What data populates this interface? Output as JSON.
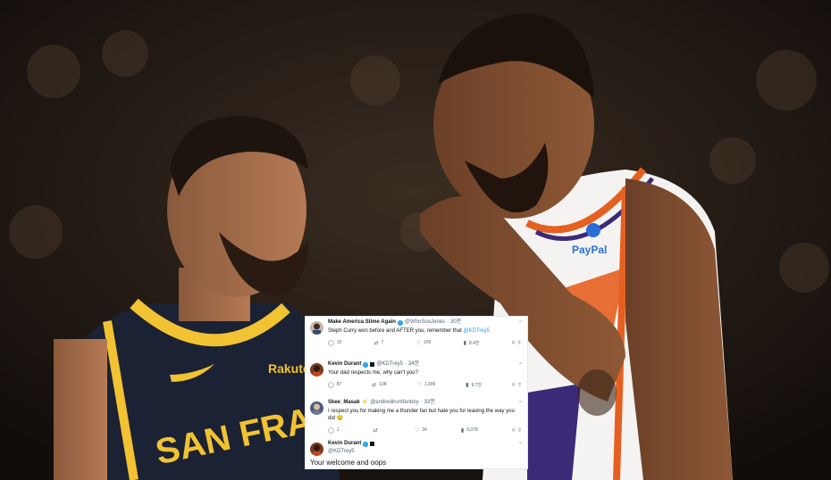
{
  "tweets": [
    {
      "name": "Make America Slime Again",
      "handle": "@WhoSooJones",
      "time": "30",
      "time_suffix": "분",
      "text": "Steph Curry won before and AFTER you, remember that ",
      "mention": "@KDTrey5",
      "replies": "15",
      "retweets": "7",
      "likes": "165",
      "views": "8.4천",
      "badge": "verified"
    },
    {
      "name": "Kevin Durant",
      "handle": "@KDTrey5",
      "time": "34",
      "time_suffix": "분",
      "text": "Your dad respects me, why can't you?",
      "replies": "87",
      "retweets": "108",
      "likes": "1,399",
      "views": "9.7천",
      "badge": "verified-square"
    },
    {
      "name": "Skee_Masak",
      "handle": "@andrediruntfanboy",
      "time": "33",
      "time_suffix": "분",
      "text": "I respect you for making me a thunder fan but hate you for leaving the way you did 😏",
      "replies": "1",
      "retweets": "",
      "likes": "34",
      "views": "6,078",
      "badge": "bolt"
    },
    {
      "name": "Kevin Durant",
      "handle": "@KDTrey5",
      "badge": "verified-square",
      "text": "Your welcome and oops"
    }
  ],
  "icons": {
    "reply": "reply-icon",
    "retweet": "retweet-icon",
    "like": "heart-icon",
    "views": "views-icon",
    "bookmark": "bookmark-icon",
    "share": "share-icon"
  },
  "photo": {
    "left_jersey_text": "SAN FRANCISCO",
    "left_sponsor": "Rakuten",
    "right_sponsor": "PayPal"
  },
  "colors": {
    "warriors_navy": "#1b2233",
    "warriors_gold": "#f1c232",
    "suns_white": "#f4f3f1",
    "suns_orange": "#e56020",
    "suns_purple": "#3a2a78",
    "link_blue": "#1d9bf0"
  }
}
